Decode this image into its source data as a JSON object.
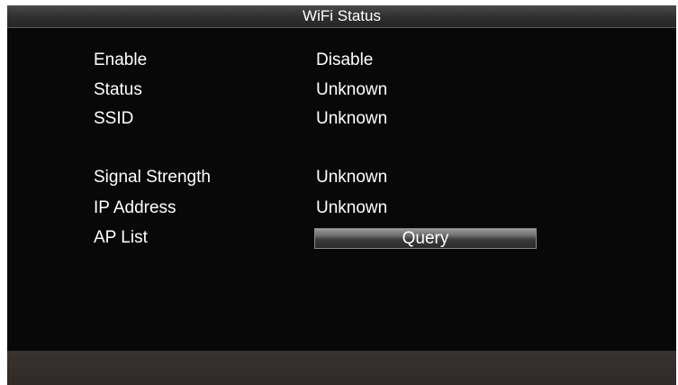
{
  "window": {
    "title": "WiFi Status"
  },
  "status": {
    "enable_label": "Enable",
    "enable_value": "Disable",
    "status_label": "Status",
    "status_value": "Unknown",
    "ssid_label": "SSID",
    "ssid_value": "Unknown",
    "signal_label": "Signal Strength",
    "signal_value": "Unknown",
    "ip_label": "IP Address",
    "ip_value": "Unknown",
    "ap_list_label": "AP List",
    "query_button": "Query"
  }
}
